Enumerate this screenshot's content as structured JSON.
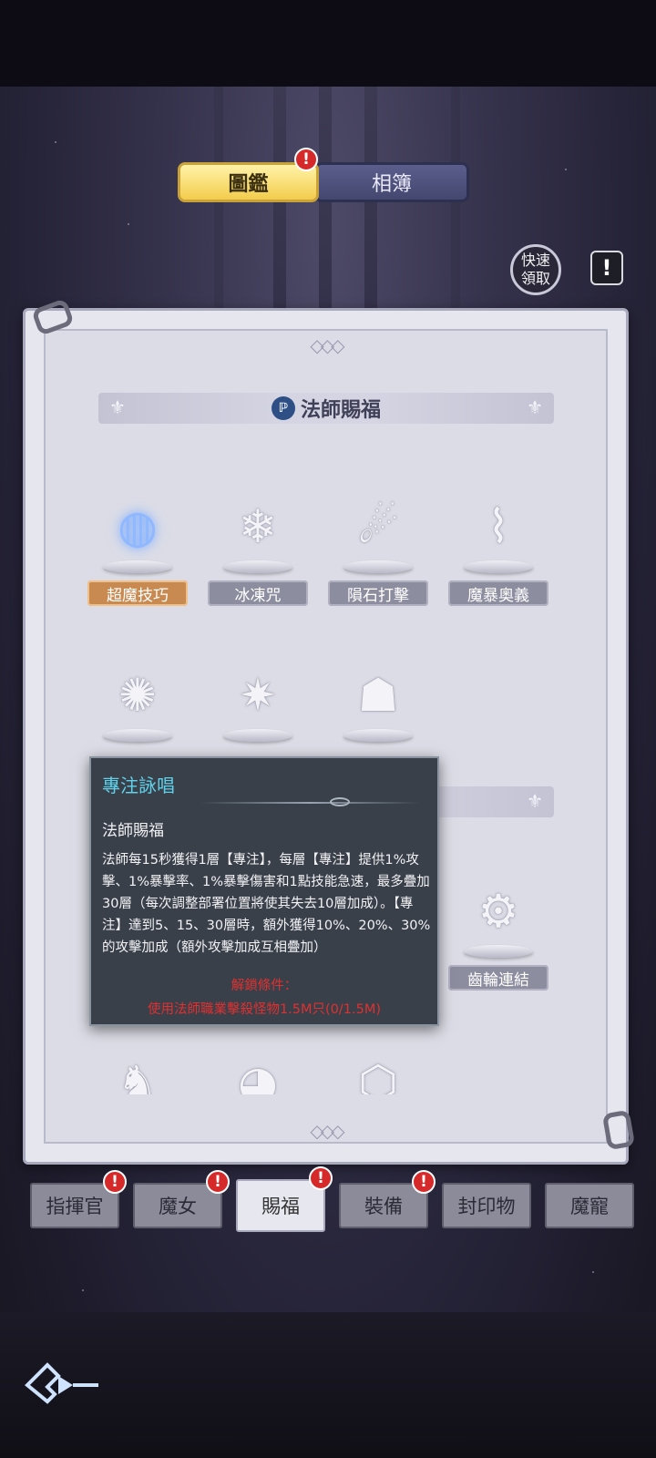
{
  "header": {
    "tabs": [
      {
        "label": "圖鑑",
        "active": true,
        "badge": "!"
      },
      {
        "label": "相簿",
        "active": false
      }
    ],
    "quick_collect": "快速\n領取",
    "info_icon": "!"
  },
  "book": {
    "section1": {
      "title": "法師賜福",
      "skills": [
        {
          "label": "超魔技巧",
          "icon": "orb-lightning-icon",
          "active": true
        },
        {
          "label": "冰凍咒",
          "icon": "snowflake-icon"
        },
        {
          "label": "隕石打擊",
          "icon": "meteor-icon"
        },
        {
          "label": "魔暴奧義",
          "icon": "vortex-icon"
        }
      ],
      "row2_icons": [
        "sparkle-orb-icon",
        "burst-icon",
        "meditation-icon"
      ]
    },
    "section2": {
      "skill_visible": {
        "label": "齒輪連結",
        "icon": "gears-icon"
      },
      "row_icons": [
        "mech-icon",
        "drill-icon",
        "gear-cube-icon"
      ]
    }
  },
  "tooltip": {
    "title": "專注詠唱",
    "category": "法師賜福",
    "description": "法師每15秒獲得1層【專注】，每層【專注】提供1%攻擊、1%暴擊率、1%暴擊傷害和1點技能急速，最多疊加30層（每次調整部署位置將使其失去10層加成）。【專注】達到5、15、30層時，額外獲得10%、20%、30%的攻擊加成（額外攻擊加成互相疊加）",
    "unlock_title": "解鎖條件：",
    "unlock_condition": "使用法師職業擊殺怪物1.5M只(0/1.5M)"
  },
  "bottom_tabs": [
    {
      "label": "指揮官",
      "badge": "!"
    },
    {
      "label": "魔女",
      "badge": "!"
    },
    {
      "label": "賜福",
      "badge": "!",
      "active": true
    },
    {
      "label": "裝備",
      "badge": "!"
    },
    {
      "label": "封印物"
    },
    {
      "label": "魔寵"
    }
  ],
  "colors": {
    "tab_active": "#f3cc4c",
    "tooltip_title": "#5fd1ea",
    "unlock_text": "#e03030",
    "badge": "#d62a2a"
  }
}
